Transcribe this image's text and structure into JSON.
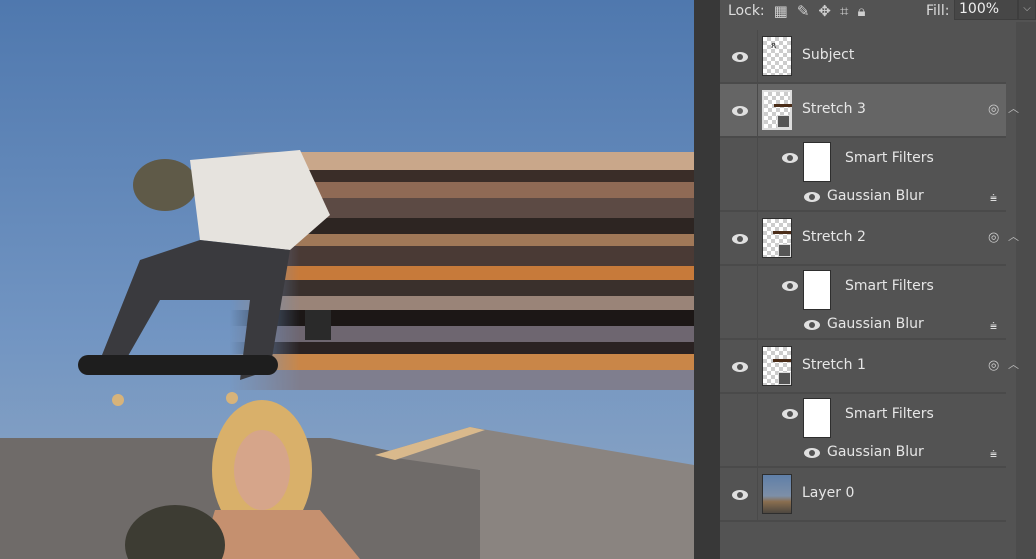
{
  "lock": {
    "label": "Lock:",
    "icons": [
      "lock-transparent-icon",
      "lock-brush-icon",
      "lock-move-icon",
      "lock-artboard-icon",
      "lock-all-icon"
    ]
  },
  "fill": {
    "label": "Fill:",
    "value": "100%"
  },
  "layers": [
    {
      "name": "Subject",
      "type": "pixel",
      "selected": false
    },
    {
      "name": "Stretch 3",
      "type": "smart",
      "selected": true,
      "smart_filters": "Smart Filters",
      "filter": "Gaussian Blur"
    },
    {
      "name": "Stretch 2",
      "type": "smart",
      "selected": false,
      "smart_filters": "Smart Filters",
      "filter": "Gaussian Blur"
    },
    {
      "name": "Stretch 1",
      "type": "smart",
      "selected": false,
      "smart_filters": "Smart Filters",
      "filter": "Gaussian Blur"
    },
    {
      "name": "Layer 0",
      "type": "photo",
      "selected": false
    }
  ],
  "colors": {
    "panel": "#535353",
    "selected": "#656565",
    "sky": "#6a8fc0"
  }
}
